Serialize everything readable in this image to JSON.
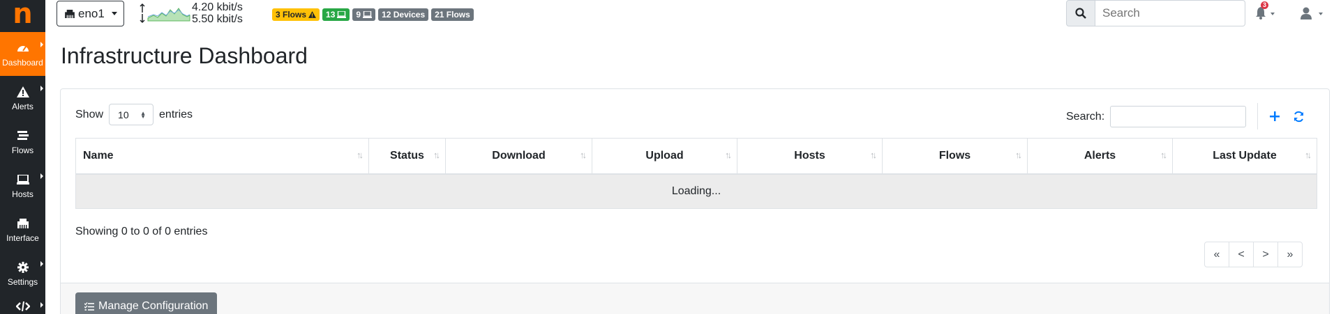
{
  "colors": {
    "brand": "#ff7500",
    "sidebar": "#212529",
    "warn": "#ffc107",
    "ok": "#28a745",
    "secondary": "#6c757d",
    "primary": "#007bff"
  },
  "logo": "n",
  "sidebar": {
    "items": [
      {
        "label": "Dashboard",
        "icon": "speedometer-icon",
        "active": true
      },
      {
        "label": "Alerts",
        "icon": "warning-icon"
      },
      {
        "label": "Flows",
        "icon": "stream-icon"
      },
      {
        "label": "Hosts",
        "icon": "laptop-icon"
      },
      {
        "label": "Interface",
        "icon": "ethernet-icon"
      },
      {
        "label": "Settings",
        "icon": "gear-icon"
      }
    ]
  },
  "topbar": {
    "interface": "eno1",
    "upload_rate": "4.20 kbit/s",
    "download_rate": "5.50 kbit/s",
    "badges": {
      "flows_alert": "3 Flows",
      "hosts_ok": "13",
      "hosts_sec": "9",
      "devices": "12 Devices",
      "flows": "21 Flows"
    },
    "search_placeholder": "Search",
    "notification_count": "3"
  },
  "page_title": "Infrastructure Dashboard",
  "table": {
    "show_label": "Show",
    "entries_label": "entries",
    "page_length": "10",
    "search_label": "Search:",
    "columns": [
      "Name",
      "Status",
      "Download",
      "Upload",
      "Hosts",
      "Flows",
      "Alerts",
      "Last Update"
    ],
    "loading_text": "Loading...",
    "info": "Showing 0 to 0 of 0 entries",
    "pager": [
      "«",
      "<",
      ">",
      "»"
    ]
  },
  "footer": {
    "manage_button": "Manage Configuration"
  }
}
